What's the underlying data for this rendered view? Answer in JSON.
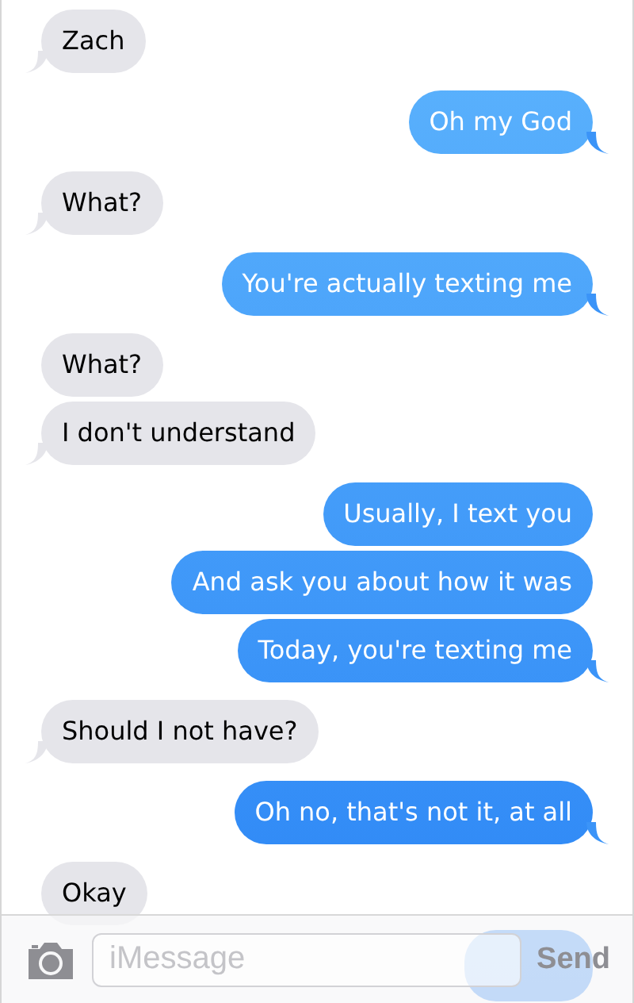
{
  "messages": [
    {
      "kind": "received",
      "text": "Zach",
      "tail": true
    },
    {
      "kind": "sent",
      "text": "Oh my God",
      "tail": true
    },
    {
      "kind": "received",
      "text": "What?",
      "tail": true
    },
    {
      "kind": "sent",
      "text": "You're actually texting me",
      "tail": true
    },
    {
      "kind": "received",
      "text": "What?",
      "tail": false
    },
    {
      "kind": "received",
      "text": "I don't understand",
      "tail": true
    },
    {
      "kind": "sent",
      "text": "Usually, I text you",
      "tail": false
    },
    {
      "kind": "sent",
      "text": "And ask you about how it was",
      "tail": false
    },
    {
      "kind": "sent",
      "text": "Today, you're texting me",
      "tail": true
    },
    {
      "kind": "received",
      "text": "Should I not have?",
      "tail": true
    },
    {
      "kind": "sent",
      "text": "Oh no, that's not it, at all",
      "tail": true
    },
    {
      "kind": "received",
      "text": "Okay",
      "tail": false
    },
    {
      "kind": "sent",
      "tail": false
    }
  ],
  "composer": {
    "placeholder": "iMessage",
    "send": "Send"
  }
}
